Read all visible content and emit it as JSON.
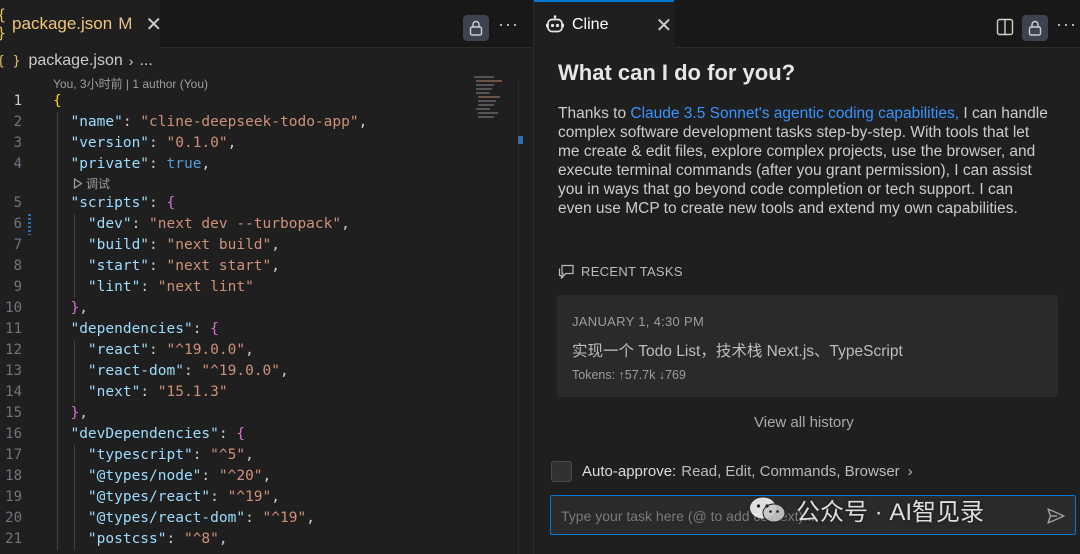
{
  "editor": {
    "tab": {
      "braces": "{ }",
      "filename": "package.json",
      "modified": "M",
      "close": "✕"
    },
    "breadcrumb": {
      "braces": "{ }",
      "file": "package.json",
      "sep": "›",
      "more": "..."
    },
    "blame": "You, 3小时前 | 1 author (You)",
    "codelens": "调试",
    "line_numbers": [
      "1",
      "2",
      "3",
      "4",
      "5",
      "6",
      "7",
      "8",
      "9",
      "10",
      "11",
      "12",
      "13",
      "14",
      "15",
      "16",
      "17",
      "18",
      "19",
      "20",
      "21"
    ],
    "code": {
      "l1_open": "{",
      "name_key": "\"name\"",
      "name_val": "\"cline-deepseek-todo-app\"",
      "version_key": "\"version\"",
      "version_val": "\"0.1.0\"",
      "private_key": "\"private\"",
      "private_val": "true",
      "scripts_key": "\"scripts\"",
      "dev_key": "\"dev\"",
      "dev_val": "\"next dev --turbopack\"",
      "build_key": "\"build\"",
      "build_val": "\"next build\"",
      "start_key": "\"start\"",
      "start_val": "\"next start\"",
      "lint_key": "\"lint\"",
      "lint_val": "\"next lint\"",
      "deps_key": "\"dependencies\"",
      "react_key": "\"react\"",
      "react_val": "\"^19.0.0\"",
      "reactdom_key": "\"react-dom\"",
      "reactdom_val": "\"^19.0.0\"",
      "next_key": "\"next\"",
      "next_val": "\"15.1.3\"",
      "devdeps_key": "\"devDependencies\"",
      "ts_key": "\"typescript\"",
      "ts_val": "\"^5\"",
      "tnode_key": "\"@types/node\"",
      "tnode_val": "\"^20\"",
      "treact_key": "\"@types/react\"",
      "treact_val": "\"^19\"",
      "treactdom_key": "\"@types/react-dom\"",
      "treactdom_val": "\"^19\"",
      "postcss_key": "\"postcss\"",
      "postcss_val": "\"^8\""
    }
  },
  "cline": {
    "tab": {
      "name": "Cline",
      "close": "✕"
    },
    "heading": "What can I do for you?",
    "intro_prefix": "Thanks to ",
    "intro_link": "Claude 3.5 Sonnet's agentic coding capabilities,",
    "intro_rest": " I can handle complex software development tasks step-by-step. With tools that let me create & edit files, explore complex projects, use the browser, and execute terminal commands (after you grant permission), I can assist you in ways that go beyond code completion or tech support. I can even use MCP to create new tools and extend my own capabilities.",
    "recent_tasks_label": "RECENT TASKS",
    "task": {
      "date": "JANUARY 1, 4:30 PM",
      "title": "实现一个 Todo List，技术栈 Next.js、TypeScript",
      "tokens": "Tokens: ↑57.7k ↓769"
    },
    "view_history": "View all history",
    "auto_approve": {
      "label": "Auto-approve:",
      "items": "Read, Edit, Commands, Browser",
      "chevron": "›"
    },
    "input_placeholder": "Type your task here (@ to add context)...",
    "watermark": "公众号 · AI智见录"
  },
  "icons": [
    "lock-icon",
    "more-icon",
    "robot-icon",
    "split-editor-icon",
    "chat-icon",
    "send-icon",
    "play-icon"
  ],
  "colors": {
    "accent": "#0078d4",
    "link": "#3794ff",
    "key": "#9cdcfe",
    "string": "#ce9178",
    "literal": "#569cd6"
  }
}
